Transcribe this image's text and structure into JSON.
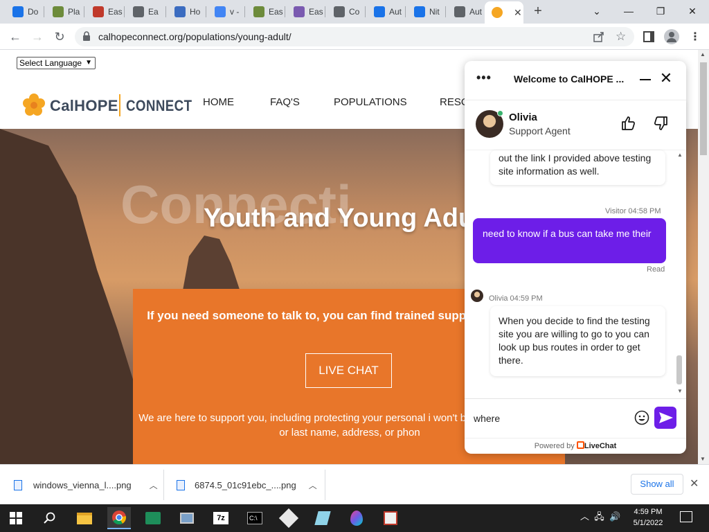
{
  "browser": {
    "tabs": [
      {
        "label": "Do"
      },
      {
        "label": "Pla"
      },
      {
        "label": "Eas"
      },
      {
        "label": "Ea"
      },
      {
        "label": "Ho"
      },
      {
        "label": "v -"
      },
      {
        "label": "Eas"
      },
      {
        "label": "Eas"
      },
      {
        "label": "Co"
      },
      {
        "label": "Aut"
      },
      {
        "label": "Nit"
      },
      {
        "label": "Aut"
      }
    ],
    "new_tab": "+",
    "url": "calhopeconnect.org/populations/young-adult/"
  },
  "page": {
    "language_select": "Select Language",
    "logo_cal": "CalHOPE",
    "logo_connect": "CONNECT",
    "nav": [
      "HOME",
      "FAQ'S",
      "POPULATIONS",
      "RESO"
    ],
    "ghost_text": "Connecti",
    "hero_title": "Youth and Young Adu",
    "box_text": "If you need someone to talk to, you can find trained supp chat with here:",
    "live_chat": "LIVE CHAT",
    "box_text2": "We are here to support you, including protecting your personal i won't be a need for your full or last name, address, or phon"
  },
  "chat": {
    "title": "Welcome to CalHOPE ...",
    "agent_name": "Olivia",
    "agent_role": "Support Agent",
    "msg1": "out the link I provided above testing site information as well.",
    "visitor_meta": "Visitor 04:58 PM",
    "msg2": "need to know if a bus can take me their",
    "read": "Read",
    "olivia_meta": "Olivia 04:59 PM",
    "msg3": "When you decide to find the testing site you are willing to go to you can look up bus routes in order to get there.",
    "input_value": "where",
    "powered_by": "Powered by",
    "brand": "LiveChat"
  },
  "downloads": {
    "items": [
      "windows_vienna_l....png",
      "6874.5_01c91ebc_....png"
    ],
    "show_all": "Show all"
  },
  "taskbar": {
    "time": "4:59 PM",
    "date": "5/1/2022"
  }
}
